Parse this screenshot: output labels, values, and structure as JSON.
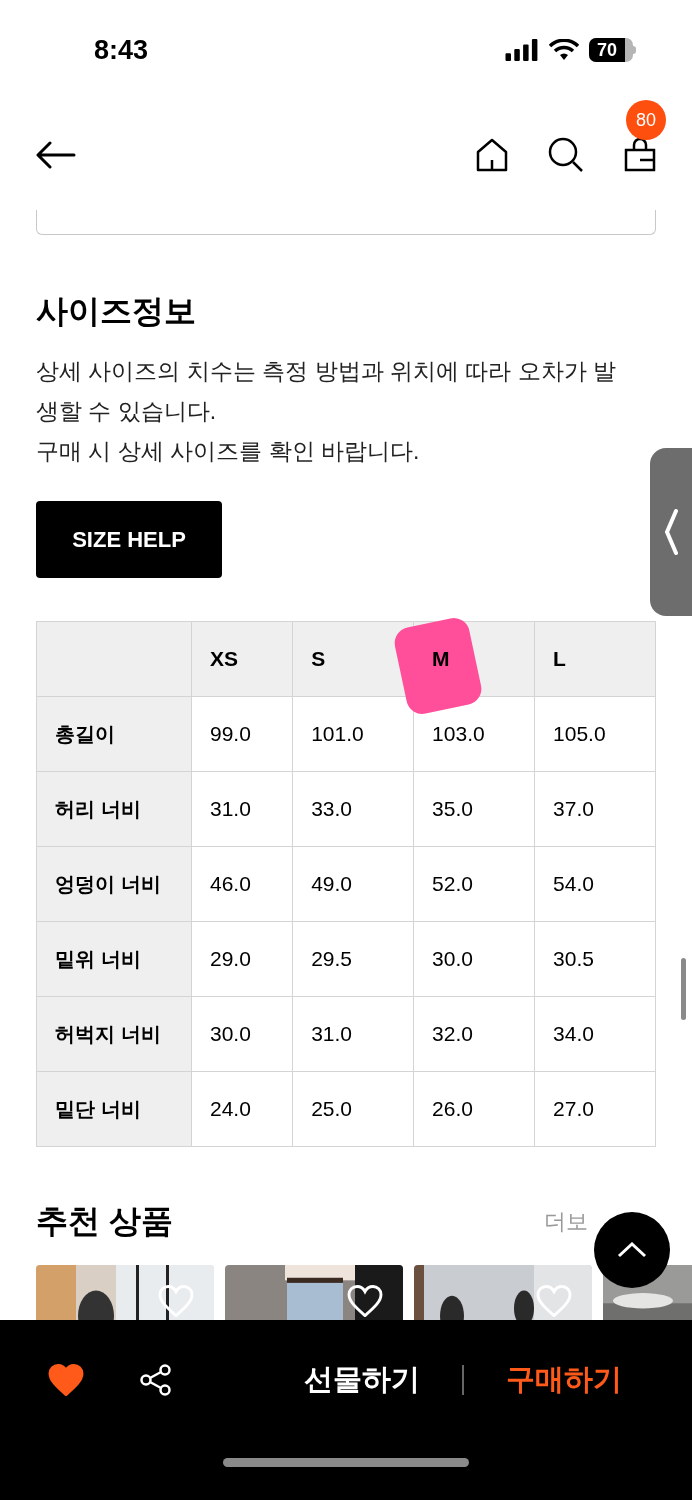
{
  "status_bar": {
    "time": "8:43",
    "battery": "70"
  },
  "header": {
    "cart_count": "80"
  },
  "size_info": {
    "title": "사이즈정보",
    "description": [
      "상세 사이즈의 치수는 측정 방법과 위치에 따라 오차가 발생할 수 있습니다.",
      "구매 시 상세 사이즈를 확인 바랍니다."
    ],
    "help_button": "SIZE HELP"
  },
  "size_table": {
    "columns": [
      {
        "label": "XS",
        "marked": false
      },
      {
        "label": "S",
        "marked": false
      },
      {
        "label": "M",
        "marked": true
      },
      {
        "label": "L",
        "marked": false
      }
    ],
    "rows": [
      {
        "label": "총길이",
        "values": [
          "99.0",
          "101.0",
          "103.0",
          "105.0"
        ]
      },
      {
        "label": "허리 너비",
        "values": [
          "31.0",
          "33.0",
          "35.0",
          "37.0"
        ]
      },
      {
        "label": "엉덩이 너비",
        "values": [
          "46.0",
          "49.0",
          "52.0",
          "54.0"
        ]
      },
      {
        "label": "밑위 너비",
        "values": [
          "29.0",
          "29.5",
          "30.0",
          "30.5"
        ]
      },
      {
        "label": "허벅지 너비",
        "values": [
          "30.0",
          "31.0",
          "32.0",
          "34.0"
        ]
      },
      {
        "label": "밑단 너비",
        "values": [
          "24.0",
          "25.0",
          "26.0",
          "27.0"
        ]
      }
    ]
  },
  "recommended": {
    "title": "추천 상품",
    "more": "더보"
  },
  "bottom_bar": {
    "liked": true,
    "gift": "선물하기",
    "buy": "구매하기"
  }
}
